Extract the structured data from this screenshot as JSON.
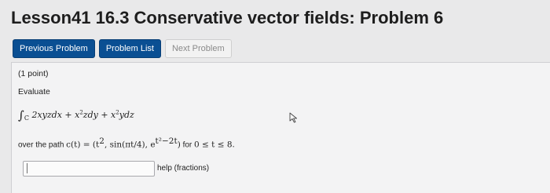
{
  "page": {
    "title": "Lesson41 16.3 Conservative vector fields: Problem 6"
  },
  "nav": {
    "previous": "Previous Problem",
    "list": "Problem List",
    "next": "Next Problem"
  },
  "problem": {
    "points": "(1 point)",
    "instruction": "Evaluate",
    "integral_symbol": "∫",
    "integral_sub": "C",
    "term1": " 2xyzdx + x",
    "term1_sup": "2",
    "term2": "zdy + x",
    "term2_sup": "2",
    "term3": "ydz",
    "path_prefix": "over the path ",
    "path_func": "c(t) = (t",
    "path_t_sup": "2",
    "path_mid": ", sin(πt/4), e",
    "path_exp": "t²−2t",
    "path_close": ")",
    "path_range_prefix": " for ",
    "path_range": "0 ≤ t ≤ 8."
  },
  "answer": {
    "value": "",
    "help": "help (fractions)"
  },
  "icons": {
    "cursor": "mouse-pointer-icon"
  }
}
